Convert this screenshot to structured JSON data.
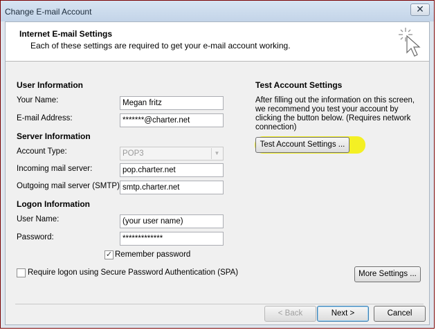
{
  "window": {
    "title": "Change E-mail Account",
    "close_glyph": "✕"
  },
  "header": {
    "title": "Internet E-mail Settings",
    "subtitle": "Each of these settings are required to get your e-mail account working."
  },
  "user_info": {
    "section": "User Information",
    "name_label": "Your Name:",
    "name_value": "Megan fritz",
    "email_label": "E-mail Address:",
    "email_value": "*******@charter.net"
  },
  "server_info": {
    "section": "Server Information",
    "account_type_label": "Account Type:",
    "account_type_value": "POP3",
    "incoming_label": "Incoming mail server:",
    "incoming_value": "pop.charter.net",
    "outgoing_label": "Outgoing mail server (SMTP):",
    "outgoing_value": "smtp.charter.net"
  },
  "logon_info": {
    "section": "Logon Information",
    "username_label": "User Name:",
    "username_value": "(your user name)",
    "password_label": "Password:",
    "password_value": "*************",
    "remember_label": "Remember password",
    "remember_checked": "✓",
    "spa_label": "Require logon using Secure Password Authentication (SPA)"
  },
  "test": {
    "section": "Test Account Settings",
    "description": "After filling out the information on this screen, we recommend you test your account by clicking the button below. (Requires network connection)",
    "button": "Test Account Settings ...",
    "highlight_color": "#f4f000"
  },
  "buttons": {
    "more_settings": "More Settings ...",
    "back": "< Back",
    "next": "Next >",
    "cancel": "Cancel"
  }
}
